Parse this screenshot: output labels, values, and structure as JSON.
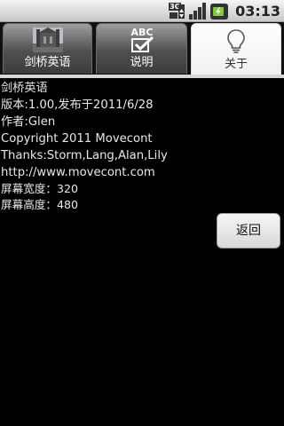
{
  "status_bar": {
    "network_label": "3G",
    "time": "03:13"
  },
  "tabs": [
    {
      "label": "剑桥英语",
      "icon": "cambridge-photo-icon",
      "active": false
    },
    {
      "label": "说明",
      "icon": "abc-check-icon",
      "active": false,
      "icon_text": "ABC"
    },
    {
      "label": "关于",
      "icon": "lightbulb-icon",
      "active": true
    }
  ],
  "about": {
    "app_name": "剑桥英语",
    "version": "版本:1.00,发布于2011/6/28",
    "author": "作者:Glen",
    "copyright": "Copyright 2011 Movecont",
    "thanks": "Thanks:Storm,Lang,Alan,Lily",
    "website": "http://www.movecont.com",
    "screen_width": "屏幕宽度：320",
    "screen_height": "屏幕高度：480"
  },
  "back_button_label": "返回",
  "colors": {
    "background": "#000000",
    "text": "#e8e8e8",
    "battery": "#7ecb3a"
  }
}
